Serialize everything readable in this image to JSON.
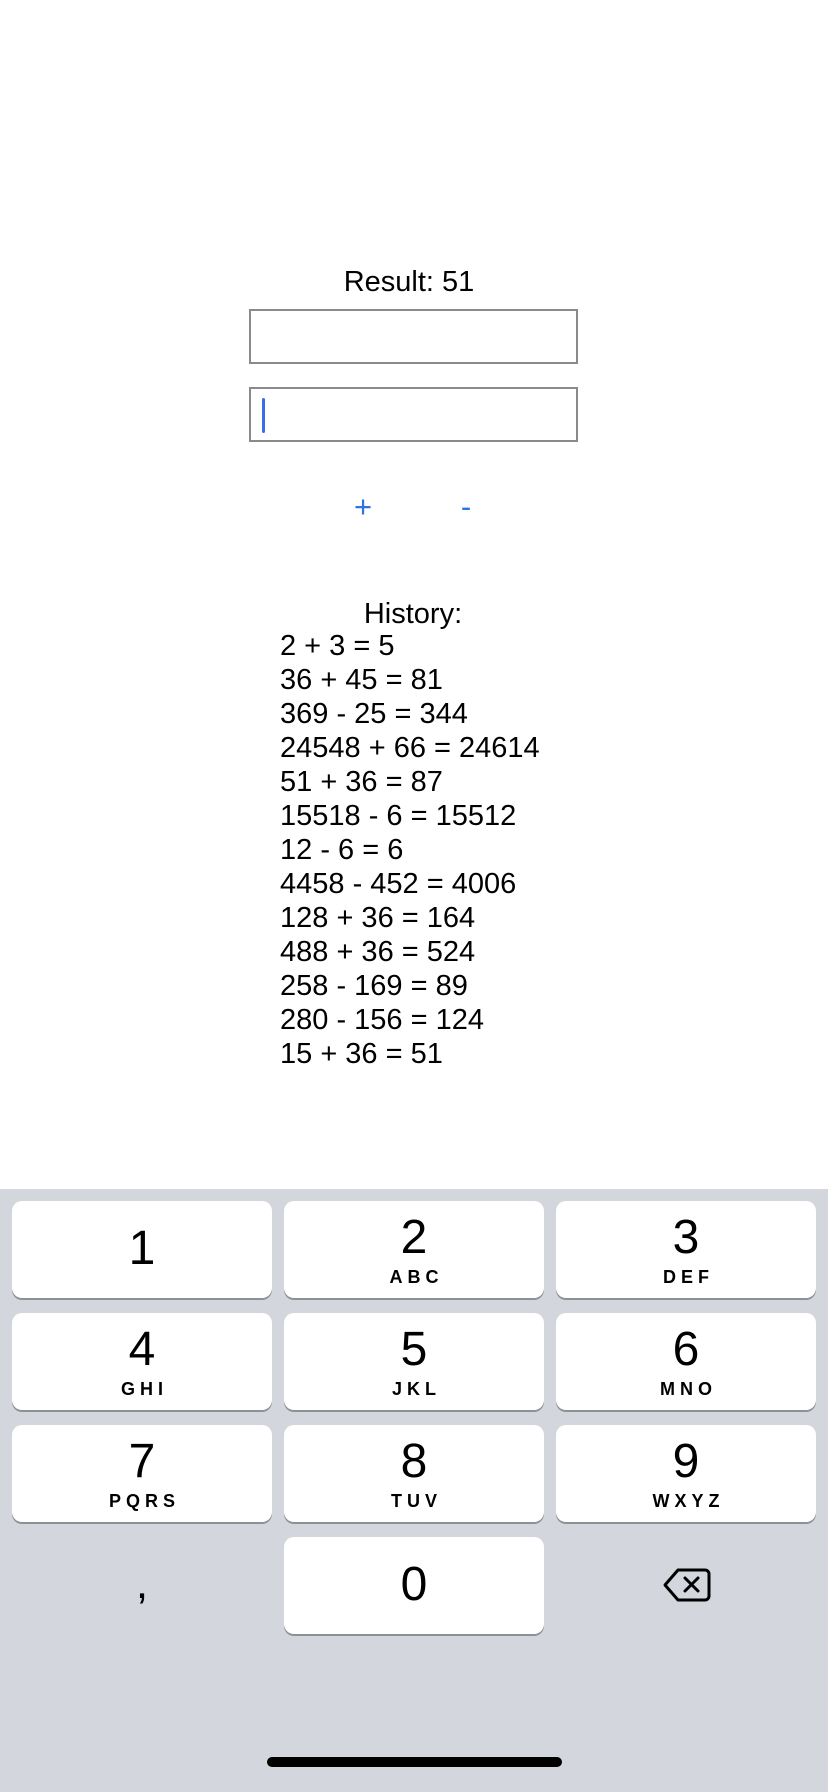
{
  "result": {
    "label": "Result: 51"
  },
  "inputs": {
    "first_value": "",
    "second_value": ""
  },
  "buttons": {
    "plus": "+",
    "minus": "-"
  },
  "history": {
    "title": "History:",
    "entries": [
      "2 + 3 = 5",
      "36 + 45 = 81",
      "369 - 25 = 344",
      "24548 + 66 = 24614",
      "51 + 36 = 87",
      "15518 - 6 = 15512",
      "12 - 6 = 6",
      "4458 - 452 = 4006",
      "128 + 36 = 164",
      "488 + 36 = 524",
      "258 - 169 = 89",
      "280 - 156 = 124",
      "15 + 36 = 51"
    ]
  },
  "keyboard": {
    "keys": [
      {
        "digit": "1",
        "letters": ""
      },
      {
        "digit": "2",
        "letters": "ABC"
      },
      {
        "digit": "3",
        "letters": "DEF"
      },
      {
        "digit": "4",
        "letters": "GHI"
      },
      {
        "digit": "5",
        "letters": "JKL"
      },
      {
        "digit": "6",
        "letters": "MNO"
      },
      {
        "digit": "7",
        "letters": "PQRS"
      },
      {
        "digit": "8",
        "letters": "TUV"
      },
      {
        "digit": "9",
        "letters": "WXYZ"
      },
      {
        "digit": "0",
        "letters": ""
      }
    ],
    "comma": ",",
    "backspace_icon": "backspace-icon"
  },
  "colors": {
    "accent": "#2f72e6",
    "caret": "#3b6ee8",
    "keyboard_background": "#d3d6dc",
    "field_border": "#8a8a8a"
  }
}
